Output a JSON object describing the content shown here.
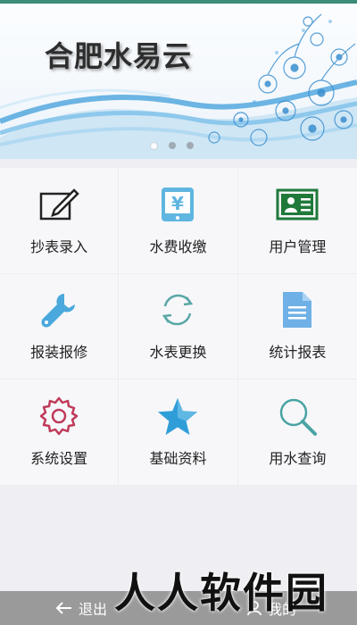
{
  "banner": {
    "title": "合肥水易云",
    "slides": 3,
    "active_slide": 1
  },
  "menu": [
    {
      "label": "抄表录入",
      "icon": "edit-icon",
      "color": "#222222"
    },
    {
      "label": "水费收缴",
      "icon": "yen-tablet-icon",
      "color": "#5fb6e0"
    },
    {
      "label": "用户管理",
      "icon": "id-card-icon",
      "color": "#1f7a3a"
    },
    {
      "label": "报装报修",
      "icon": "wrench-icon",
      "color": "#4aa8dc"
    },
    {
      "label": "水表更换",
      "icon": "refresh-icon",
      "color": "#5aa7a7"
    },
    {
      "label": "统计报表",
      "icon": "document-icon",
      "color": "#6fb1e6"
    },
    {
      "label": "系统设置",
      "icon": "gear-icon",
      "color": "#c03a5a"
    },
    {
      "label": "基础资料",
      "icon": "star-icon",
      "color": "#2f9ed8"
    },
    {
      "label": "用水查询",
      "icon": "search-icon",
      "color": "#4aa3a3"
    }
  ],
  "bottom_bar": {
    "exit_label": "退出",
    "mine_label": "我的"
  },
  "watermark": "人人软件园"
}
